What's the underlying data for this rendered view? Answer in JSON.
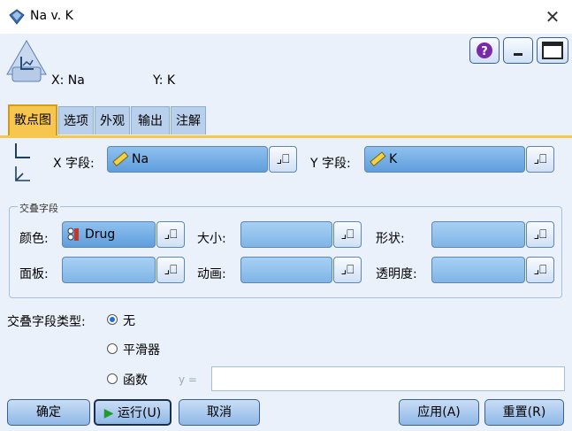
{
  "window": {
    "title": "Na v. K",
    "close": "✕"
  },
  "header": {
    "x_label": "X: Na",
    "y_label": "Y: K"
  },
  "tabs": [
    "散点图",
    "选项",
    "外观",
    "输出",
    "注解"
  ],
  "fields": {
    "x_label": "X 字段:",
    "x_value": "Na",
    "y_label": "Y 字段:",
    "y_value": "K"
  },
  "overlay": {
    "title": "交叠字段",
    "color_label": "颜色:",
    "color_value": "Drug",
    "size_label": "大小:",
    "size_value": "",
    "shape_label": "形状:",
    "shape_value": "",
    "panel_label": "面板:",
    "panel_value": "",
    "anim_label": "动画:",
    "anim_value": "",
    "transp_label": "透明度:",
    "transp_value": ""
  },
  "overlay_type": {
    "label": "交叠字段类型:",
    "options": [
      "无",
      "平滑器",
      "函数"
    ],
    "selected": "无",
    "y_eq": "y =",
    "func_value": ""
  },
  "buttons": {
    "ok": "确定",
    "run": "运行(U)",
    "cancel": "取消",
    "apply": "应用(A)",
    "reset": "重置(R)"
  },
  "colors": {
    "accent": "#f7c64f",
    "field_blue": "#7fb5e6",
    "bg": "#eaf1fa"
  }
}
